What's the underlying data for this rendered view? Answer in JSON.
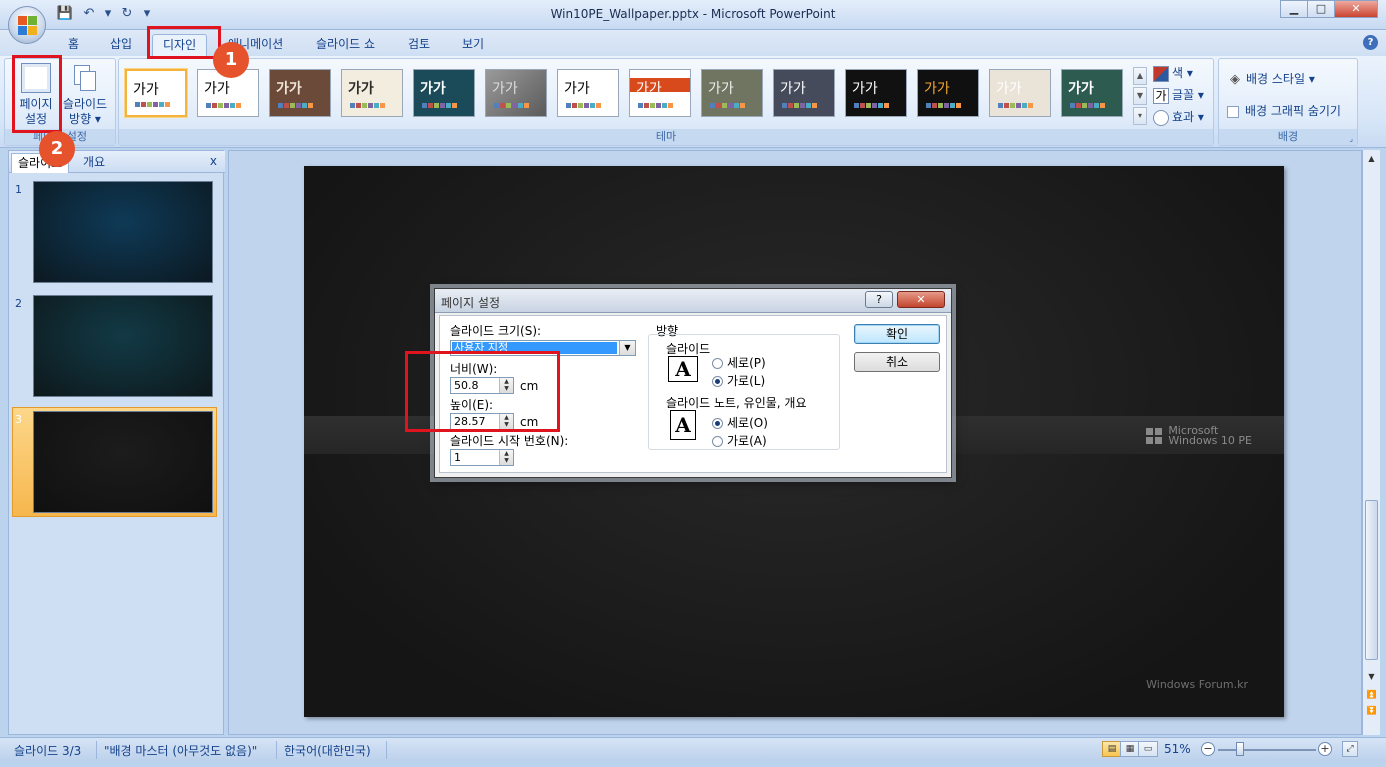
{
  "window": {
    "title": "Win10PE_Wallpaper.pptx - Microsoft PowerPoint",
    "controls": {
      "minimize": "▁",
      "maximize": "□",
      "close": "✕"
    }
  },
  "qat": {
    "save": "💾",
    "undo": "↶",
    "undo_dd": "▾",
    "redo": "↻",
    "customize": "▾"
  },
  "tabs": [
    "홈",
    "삽입",
    "디자인",
    "애니메이션",
    "슬라이드 쇼",
    "검토",
    "보기"
  ],
  "active_tab": "디자인",
  "help": "?",
  "ribbon": {
    "page_setup": {
      "page_setup_label_1": "페이지",
      "page_setup_label_2": "설정",
      "orientation_label_1": "슬라이드",
      "orientation_label_2": "방향 ▾",
      "group_label": "페이지 설정"
    },
    "themes": {
      "group_label": "테마",
      "items": [
        {
          "text": "가가",
          "bg": "#ffffff",
          "fg": "#000000"
        },
        {
          "text": "가가",
          "bg": "#ffffff",
          "fg": "#000000"
        },
        {
          "text": "가가",
          "bg": "#6b4a3a",
          "fg": "#f0e6d8"
        },
        {
          "text": "가가",
          "bg": "#f3ede0",
          "fg": "#2c2c2c"
        },
        {
          "text": "가가",
          "bg": "#1b4a59",
          "fg": "#ffffff"
        },
        {
          "text": "가가",
          "bg": "#7a7a7a",
          "fg": "#dddddd"
        },
        {
          "text": "가가",
          "bg": "#ffffff",
          "fg": "#000000"
        },
        {
          "text": "가가",
          "bg": "#ffffff",
          "fg": "#ffffff"
        },
        {
          "text": "가가",
          "bg": "#6f7560",
          "fg": "#eeeeee"
        },
        {
          "text": "가가",
          "bg": "#454b5a",
          "fg": "#ffffff"
        },
        {
          "text": "가가",
          "bg": "#111111",
          "fg": "#ffffff"
        },
        {
          "text": "가가",
          "bg": "#101010",
          "fg": "#f3a632"
        },
        {
          "text": "가가",
          "bg": "#eae3d8",
          "fg": "#ffffff"
        },
        {
          "text": "가가",
          "bg": "#2d5b50",
          "fg": "#ffffff"
        }
      ],
      "colors_label": "색 ▾",
      "fonts_label": "글꼴 ▾",
      "effects_label": "효과 ▾",
      "fonts_icon_char": "가"
    },
    "background": {
      "group_label": "배경",
      "styles_label": "배경 스타일 ▾",
      "hide_graphics_label": "배경 그래픽 숨기기"
    }
  },
  "left_pane": {
    "tab_slides": "슬라이드",
    "tab_outline": "개요",
    "close": "x",
    "slides": [
      {
        "num": "1",
        "color": "#0e3a57"
      },
      {
        "num": "2",
        "color": "#123a46"
      },
      {
        "num": "3",
        "color": "#1c1c1c"
      }
    ]
  },
  "slide": {
    "logo_line1": "Microsoft",
    "logo_line2": "Windows 10 PE",
    "footer": "Windows Forum.kr"
  },
  "dialog": {
    "title": "페이지 설정",
    "help": "?",
    "close": "✕",
    "slide_size_label": "슬라이드 크기(S):",
    "slide_size_value": "사용자 지정",
    "width_label": "너비(W):",
    "width_value": "50.8",
    "width_unit": "cm",
    "height_label": "높이(E):",
    "height_value": "28.57",
    "height_unit": "cm",
    "start_number_label": "슬라이드 시작 번호(N):",
    "start_number_value": "1",
    "orientation_label": "방향",
    "slides_section": "슬라이드",
    "slides_portrait": "세로(P)",
    "slides_landscape": "가로(L)",
    "notes_section": "슬라이드 노트, 유인물, 개요",
    "notes_portrait": "세로(O)",
    "notes_landscape": "가로(A)",
    "ok": "확인",
    "cancel": "취소",
    "icon_letter": "A"
  },
  "annotations": {
    "badge1": "1",
    "badge2": "2"
  },
  "status": {
    "slide_counter": "슬라이드 3/3",
    "theme": "\"배경 마스터 (아무것도 없음)\"",
    "language": "한국어(대한민국)",
    "zoom": "51%"
  }
}
